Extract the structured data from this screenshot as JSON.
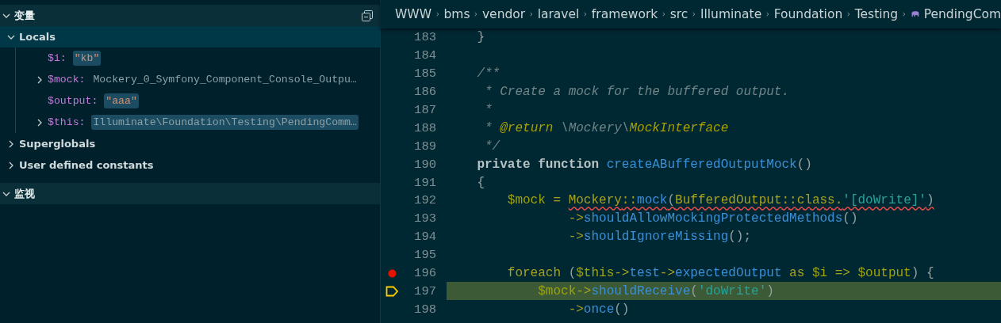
{
  "variables_panel": {
    "title": "变量",
    "expanded": true,
    "scopes": [
      {
        "label": "Locals",
        "expanded": true,
        "selected": true,
        "children": [
          {
            "name": "$i:",
            "value": "\"kb\"",
            "kind": "string",
            "changed": true
          },
          {
            "name": "$mock:",
            "value": "Mockery_0_Symfony_Component_Console_Outpu…",
            "kind": "object",
            "expanded": false,
            "changed": false
          },
          {
            "name": "$output:",
            "value": "\"aaa\"",
            "kind": "string",
            "changed": true
          },
          {
            "name": "$this:",
            "value": "Illuminate\\Foundation\\Testing\\PendingComm…",
            "kind": "object",
            "expanded": false,
            "changed": true
          }
        ]
      },
      {
        "label": "Superglobals",
        "expanded": false,
        "selected": false
      },
      {
        "label": "User defined constants",
        "expanded": false,
        "selected": false
      }
    ]
  },
  "watch_panel": {
    "title": "监视",
    "expanded": true
  },
  "breadcrumbs": [
    "WWW",
    "bms",
    "vendor",
    "laravel",
    "framework",
    "src",
    "Illuminate",
    "Foundation",
    "Testing",
    "PendingCom"
  ],
  "code_lines": [
    {
      "number": "183",
      "breakpoint": false,
      "current": false,
      "tokens": [
        {
          "t": "    }",
          "kind": "plain"
        }
      ]
    },
    {
      "number": "184",
      "breakpoint": false,
      "current": false
    },
    {
      "number": "185",
      "breakpoint": false,
      "current": false,
      "tokens": [
        {
          "t": "    /**",
          "kind": "comment"
        }
      ]
    },
    {
      "number": "186",
      "breakpoint": false,
      "current": false,
      "tokens": [
        {
          "t": "     * Create a mock for the buffered output.",
          "kind": "comment"
        }
      ]
    },
    {
      "number": "187",
      "breakpoint": false,
      "current": false,
      "tokens": [
        {
          "t": "     *",
          "kind": "comment"
        }
      ]
    },
    {
      "number": "188",
      "breakpoint": false,
      "current": false,
      "tokens": [
        {
          "t": "     * ",
          "kind": "comment"
        },
        {
          "t": "@return",
          "kind": "doctag"
        },
        {
          "t": " \\Mockery\\",
          "kind": "comment"
        },
        {
          "t": "MockInterface",
          "kind": "doctag"
        }
      ]
    },
    {
      "number": "189",
      "breakpoint": false,
      "current": false,
      "tokens": [
        {
          "t": "     */",
          "kind": "comment"
        }
      ]
    },
    {
      "number": "190",
      "breakpoint": false,
      "current": false,
      "tokens": [
        {
          "t": "    private function ",
          "kind": "modifier"
        },
        {
          "t": "createABufferedOutputMock",
          "kind": "function"
        },
        {
          "t": "()",
          "kind": "plain"
        }
      ]
    },
    {
      "number": "191",
      "breakpoint": false,
      "current": false,
      "tokens": [
        {
          "t": "    {",
          "kind": "plain"
        }
      ]
    },
    {
      "number": "192",
      "breakpoint": false,
      "current": false,
      "tokens": [
        {
          "t": "        $mock",
          "kind": "variable",
          "error": false
        },
        {
          "t": " = ",
          "kind": "keyword",
          "error": false
        },
        {
          "t": "Mockery",
          "kind": "class",
          "error": true
        },
        {
          "t": "::",
          "kind": "keyword",
          "error": true
        },
        {
          "t": "mock",
          "kind": "function",
          "error": true
        },
        {
          "t": "(",
          "kind": "plain",
          "error": true
        },
        {
          "t": "BufferedOutput",
          "kind": "class",
          "error": true
        },
        {
          "t": "::class.",
          "kind": "keyword",
          "error": true
        },
        {
          "t": "'[doWrite]'",
          "kind": "string",
          "error": true
        },
        {
          "t": ")",
          "kind": "plain",
          "error": true
        }
      ]
    },
    {
      "number": "193",
      "breakpoint": false,
      "current": false,
      "tokens": [
        {
          "t": "                ->",
          "kind": "keyword"
        },
        {
          "t": "shouldAllowMockingProtectedMethods",
          "kind": "function"
        },
        {
          "t": "()",
          "kind": "plain"
        }
      ]
    },
    {
      "number": "194",
      "breakpoint": false,
      "current": false,
      "tokens": [
        {
          "t": "                ->",
          "kind": "keyword"
        },
        {
          "t": "shouldIgnoreMissing",
          "kind": "function"
        },
        {
          "t": "();",
          "kind": "plain"
        }
      ]
    },
    {
      "number": "195",
      "breakpoint": false,
      "current": false
    },
    {
      "number": "196",
      "breakpoint": true,
      "current": false,
      "tokens": [
        {
          "t": "        foreach",
          "kind": "keyword"
        },
        {
          "t": " (",
          "kind": "plain"
        },
        {
          "t": "$this",
          "kind": "variable"
        },
        {
          "t": "->",
          "kind": "keyword"
        },
        {
          "t": "test",
          "kind": "function"
        },
        {
          "t": "->",
          "kind": "keyword"
        },
        {
          "t": "expectedOutput",
          "kind": "function"
        },
        {
          "t": " as ",
          "kind": "keyword"
        },
        {
          "t": "$i",
          "kind": "variable"
        },
        {
          "t": " => ",
          "kind": "keyword"
        },
        {
          "t": "$output",
          "kind": "variable"
        },
        {
          "t": ") {",
          "kind": "plain"
        }
      ]
    },
    {
      "number": "197",
      "breakpoint": false,
      "current": true,
      "tokens": [
        {
          "t": "            $mock",
          "kind": "variable"
        },
        {
          "t": "->",
          "kind": "keyword"
        },
        {
          "t": "shouldReceive",
          "kind": "function"
        },
        {
          "t": "(",
          "kind": "plain"
        },
        {
          "t": "'doWrite'",
          "kind": "string"
        },
        {
          "t": ")",
          "kind": "plain"
        }
      ]
    },
    {
      "number": "198",
      "breakpoint": false,
      "current": false,
      "tokens": [
        {
          "t": "                ->",
          "kind": "keyword"
        },
        {
          "t": "once",
          "kind": "function"
        },
        {
          "t": "()",
          "kind": "plain"
        }
      ]
    }
  ]
}
